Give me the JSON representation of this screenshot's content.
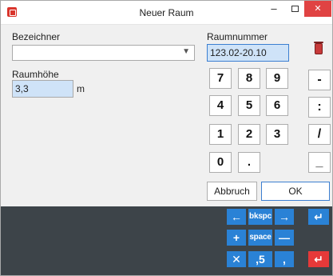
{
  "window": {
    "title": "Neuer Raum",
    "controls": {
      "minimize": "–",
      "close": "✕"
    }
  },
  "form": {
    "bezeichner_label": "Bezeichner",
    "bezeichner_value": "",
    "raumhoehe_label": "Raumhöhe",
    "raumhoehe_value": "3,3",
    "raumhoehe_unit": "m",
    "raumnummer_label": "Raumnummer",
    "raumnummer_value": "123.02-20.10"
  },
  "keypad": {
    "keys": [
      "7",
      "8",
      "9",
      "4",
      "5",
      "6",
      "1",
      "2",
      "3",
      "0",
      "."
    ],
    "ops": [
      "-",
      ":",
      "/",
      "_"
    ]
  },
  "buttons": {
    "cancel": "Abbruch",
    "ok": "OK"
  },
  "onscreen_keyboard": {
    "row1": [
      "←",
      "bkspc",
      "→",
      "↵"
    ],
    "row2": [
      "+",
      "space",
      "—"
    ],
    "row3": [
      "✕",
      ",5",
      ",",
      "↵"
    ]
  },
  "colors": {
    "accent_blue": "#2a82d6",
    "field_bg": "#cfe3f8",
    "panel_bg": "#3d4449",
    "close_red": "#e04343",
    "enter_red": "#e63939"
  }
}
